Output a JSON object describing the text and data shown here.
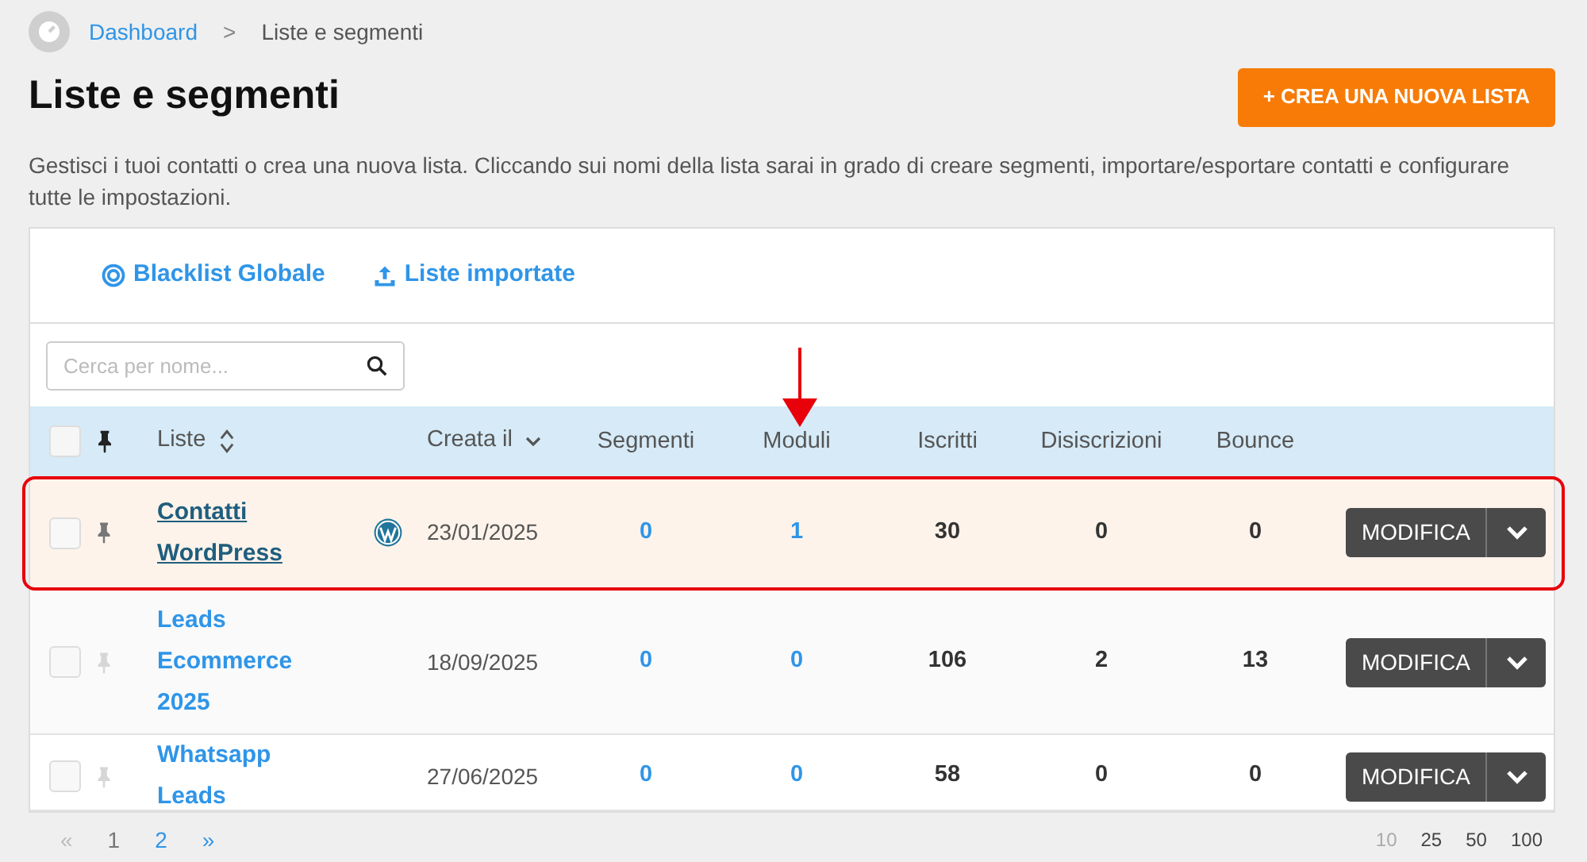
{
  "breadcrumb": [
    "Dashboard",
    "Liste e segmenti"
  ],
  "breadcrumb_separator": ">",
  "select_all_checked": false,
  "title": "Liste e segmenti",
  "create_button": "+ CREA UNA NUOVA LISTA",
  "description": "Gestisci i tuoi contatti o crea una nuova lista. Cliccando sui nomi della lista sarai in grado di creare segmenti, importare/esportare contatti e configurare tutte le impostazioni.",
  "links": [
    {
      "kind": "blacklist",
      "label": "Blacklist Globale"
    },
    {
      "kind": "import",
      "label": "Liste importate"
    }
  ],
  "search": {
    "placeholder": "Cerca per nome..."
  },
  "table": {
    "columns": [
      "Liste",
      "Creata il",
      "Segmenti",
      "Moduli",
      "Iscritti",
      "Disiscrizioni",
      "Bounce"
    ],
    "rows": [
      {
        "name": "Contatti WordPress",
        "pinned": true,
        "kind": "wordpress",
        "highlighted": true,
        "checked": false,
        "date": "23/01/2025",
        "segments": "0",
        "forms": "1",
        "subscribers": "30",
        "unsubscribed": "0",
        "bounce": "0",
        "action": "MODIFICA"
      },
      {
        "name": "Leads Ecommerce 2025",
        "pinned": false,
        "kind": "plain",
        "highlighted": false,
        "checked": false,
        "date": "18/09/2025",
        "segments": "0",
        "forms": "0",
        "subscribers": "106",
        "unsubscribed": "2",
        "bounce": "13",
        "action": "MODIFICA"
      },
      {
        "name": "Whatsapp Leads",
        "pinned": false,
        "kind": "plain",
        "highlighted": false,
        "checked": false,
        "date": "27/06/2025",
        "segments": "0",
        "forms": "0",
        "subscribers": "58",
        "unsubscribed": "0",
        "bounce": "0",
        "action": "MODIFICA"
      }
    ]
  },
  "annotation_arrow": true,
  "pagination": {
    "prev": "«",
    "next": "»",
    "pages": [
      {
        "label": "1",
        "selected": true
      },
      {
        "label": "2",
        "selected": false
      }
    ]
  },
  "page_sizes": [
    {
      "label": "10",
      "selected": true
    },
    {
      "label": "25",
      "selected": false
    },
    {
      "label": "50",
      "selected": false
    },
    {
      "label": "100",
      "selected": false
    }
  ]
}
